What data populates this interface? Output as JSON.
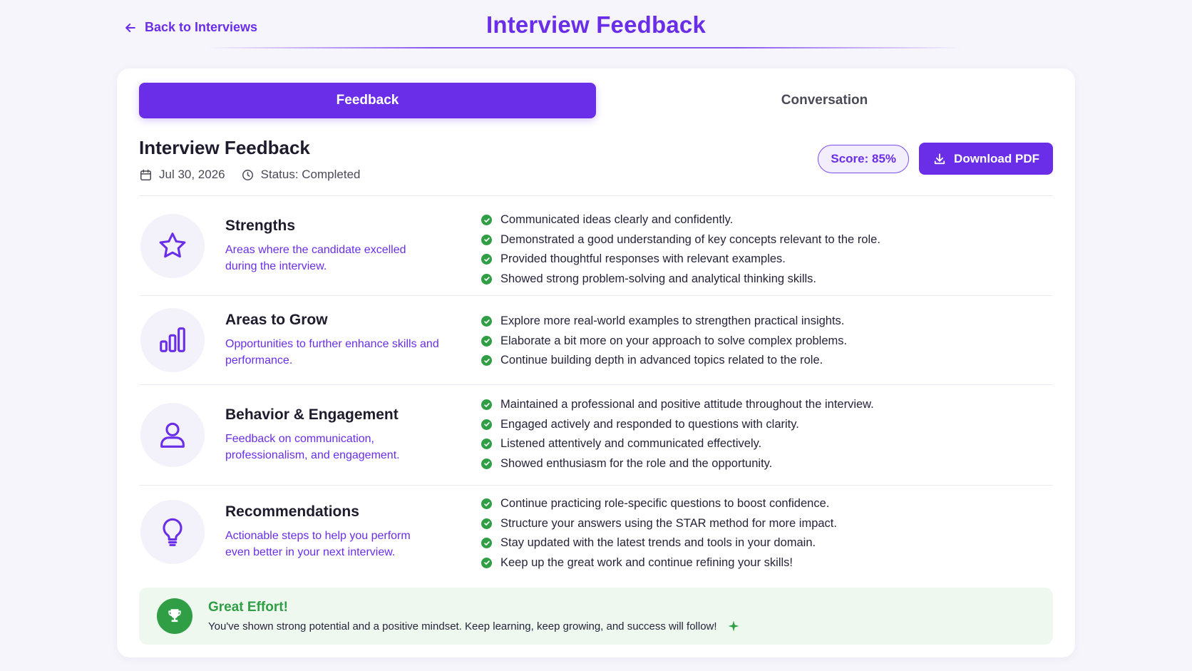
{
  "header": {
    "back_label": "Back to Interviews",
    "title": "Interview Feedback"
  },
  "tabs": [
    {
      "label": "Feedback",
      "active": true
    },
    {
      "label": "Conversation",
      "active": false
    }
  ],
  "feedback": {
    "title": "Interview Feedback",
    "date": "Jul 30, 2026",
    "status": "Status: Completed",
    "score": "Score: 85%",
    "download_label": "Download PDF"
  },
  "sections": [
    {
      "icon": "star-icon",
      "title": "Strengths",
      "desc": "Areas where the candidate excelled during the interview.",
      "items": [
        "Communicated ideas clearly and confidently.",
        "Demonstrated a good understanding of key concepts relevant to the role.",
        "Provided thoughtful responses with relevant examples.",
        "Showed strong problem-solving and analytical thinking skills."
      ]
    },
    {
      "icon": "bar-chart-icon",
      "title": "Areas to Grow",
      "desc": "Opportunities to further enhance skills and performance.",
      "items": [
        "Explore more real-world examples to strengthen practical insights.",
        "Elaborate a bit more on your approach to solve complex problems.",
        "Continue building depth in advanced topics related to the role."
      ]
    },
    {
      "icon": "user-icon",
      "title": "Behavior & Engagement",
      "desc": "Feedback on communication, professionalism, and engagement.",
      "items": [
        "Maintained a professional and positive attitude throughout the interview.",
        "Engaged actively and responded to questions with clarity.",
        "Listened attentively and communicated effectively.",
        "Showed enthusiasm for the role and the opportunity."
      ]
    },
    {
      "icon": "lightbulb-icon",
      "title": "Recommendations",
      "desc": "Actionable steps to help you perform even better in your next interview.",
      "items": [
        "Continue practicing role-specific questions to boost confidence.",
        "Structure your answers using the STAR method for more impact.",
        "Stay updated with the latest trends and tools in your domain.",
        "Keep up the great work and continue refining your skills!"
      ]
    }
  ],
  "effort": {
    "title": "Great Effort!",
    "message": "You've shown strong potential and a positive mindset. Keep learning, keep growing, and success will follow!"
  },
  "colors": {
    "accent": "#6a2ee8",
    "success": "#2f9e44",
    "background": "#f6f5fb"
  }
}
